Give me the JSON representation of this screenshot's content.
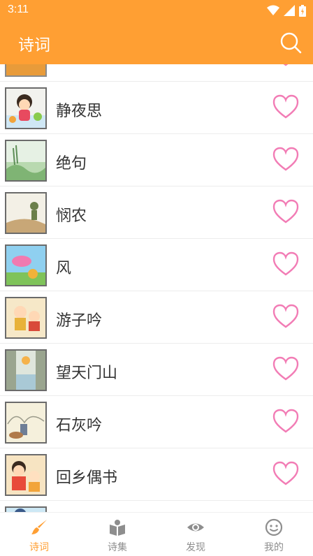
{
  "status_bar": {
    "time": "3:11"
  },
  "app_bar": {
    "title": "诗词"
  },
  "colors": {
    "accent": "#ff9f33",
    "heart": "#f27cb5",
    "inactive": "#8e8e8e"
  },
  "poems": [
    {
      "title": "静夜思"
    },
    {
      "title": "绝句"
    },
    {
      "title": "悯农"
    },
    {
      "title": "风"
    },
    {
      "title": "游子吟"
    },
    {
      "title": "望天门山"
    },
    {
      "title": "石灰吟"
    },
    {
      "title": "回乡偶书"
    }
  ],
  "bottom_nav": {
    "items": [
      {
        "label": "诗词",
        "icon": "brush-icon",
        "active": true
      },
      {
        "label": "诗集",
        "icon": "book-icon",
        "active": false
      },
      {
        "label": "发现",
        "icon": "eye-icon",
        "active": false
      },
      {
        "label": "我的",
        "icon": "smiley-icon",
        "active": false
      }
    ]
  }
}
